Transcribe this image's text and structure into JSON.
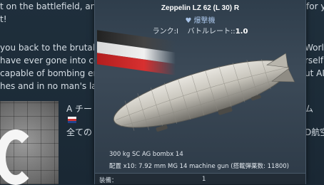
{
  "background": {
    "lines": [
      "t on the battlefield, and p",
      "t!",
      "you back to the brutal bat",
      "have ever gone into comb",
      "capable of bombing ene",
      "hes and in no man's land"
    ],
    "right_lines": [
      "for y",
      "World",
      "rself",
      "ut AI i"
    ],
    "post_title": "A チー",
    "post_title_right": "ム",
    "post_body": "全ての",
    "post_body_right": "D航空"
  },
  "tooltip": {
    "title": "Zeppelin LZ 62 (L 30) R",
    "type_label": "爆撃機",
    "rank_label": "ランク:",
    "rank_value": "I",
    "br_label": "バトルレート::",
    "br_value": "1.0",
    "bomb_line": "300 kg SC AG bombx 14",
    "gun_line": "配置 x10: 7.92 mm MG 14 machine gun (搭載弾薬数: 11800)",
    "equip_label": "装備：",
    "equip_value": "1"
  },
  "colors": {
    "card_bg": "#3c4a58",
    "type_color": "#a9c4e8",
    "page_bg": "#1b2a37"
  },
  "icons": [
    "heart-icon",
    "german-flag-icon",
    "zeppelin-image",
    "uk-flag-icon"
  ]
}
